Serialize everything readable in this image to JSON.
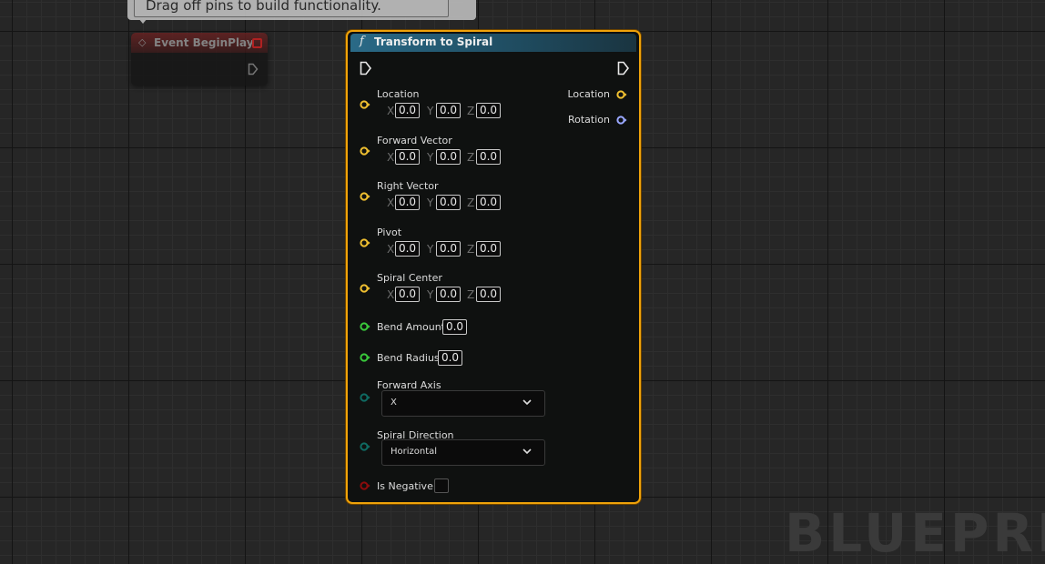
{
  "comment": {
    "text": "Drag off pins to build functionality."
  },
  "event_node": {
    "title": "Event BeginPlay"
  },
  "node": {
    "title": "Transform to Spiral",
    "function_glyph": "f",
    "vector_inputs": [
      {
        "label": "Location",
        "x": "0.0",
        "y": "0.0",
        "z": "0.0"
      },
      {
        "label": "Forward Vector",
        "x": "0.0",
        "y": "0.0",
        "z": "0.0"
      },
      {
        "label": "Right Vector",
        "x": "0.0",
        "y": "0.0",
        "z": "0.0"
      },
      {
        "label": "Pivot",
        "x": "0.0",
        "y": "0.0",
        "z": "0.0"
      },
      {
        "label": "Spiral Center",
        "x": "0.0",
        "y": "0.0",
        "z": "0.0"
      }
    ],
    "axis_labels": {
      "x": "X",
      "y": "Y",
      "z": "Z"
    },
    "bend_amount": {
      "label": "Bend Amount",
      "value": "0.0"
    },
    "bend_radius": {
      "label": "Bend Radius",
      "value": "0.0"
    },
    "forward_axis": {
      "label": "Forward Axis",
      "value": "X"
    },
    "spiral_direction": {
      "label": "Spiral Direction",
      "value": "Horizontal"
    },
    "is_negative": {
      "label": "Is Negative",
      "checked": false
    },
    "outputs": [
      {
        "label": "Location",
        "type": "vector"
      },
      {
        "label": "Rotation",
        "type": "rotator"
      }
    ]
  },
  "watermark": {
    "text": "BLUEPRI"
  },
  "colors": {
    "vector_pin": "#f0c030",
    "float_pin": "#39c93b",
    "enum_pin": "#0f6b63",
    "bool_pin": "#8c0c0c",
    "rotator_pin": "#9aa8ff",
    "selected_outline": "#f0a30a"
  }
}
